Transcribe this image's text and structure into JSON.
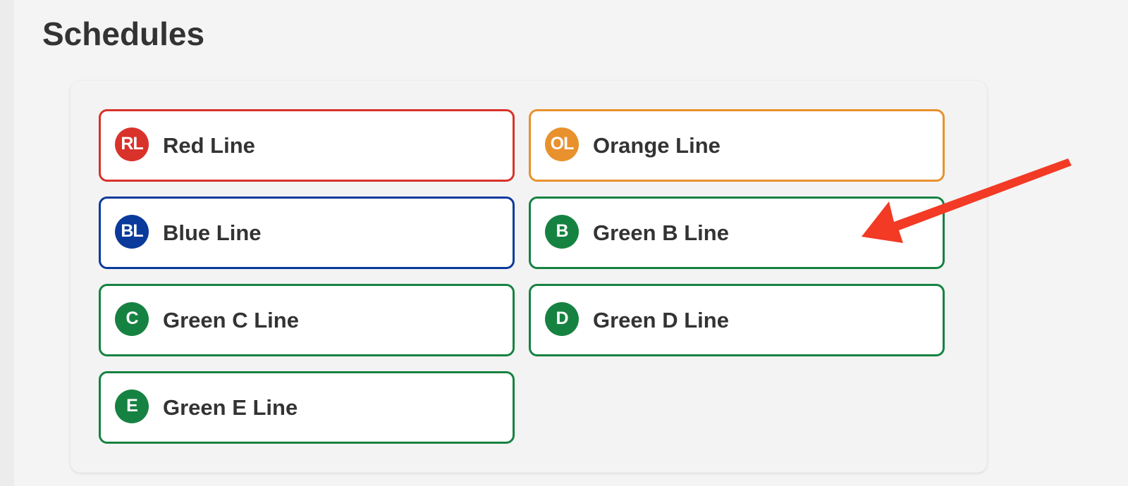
{
  "header": {
    "title": "Schedules"
  },
  "lines": [
    {
      "badge": "RL",
      "label": "Red Line",
      "color": "#d9322a",
      "badge_icon": "red-line-badge-icon"
    },
    {
      "badge": "OL",
      "label": "Orange Line",
      "color": "#e8912d",
      "badge_icon": "orange-line-badge-icon"
    },
    {
      "badge": "BL",
      "label": "Blue Line",
      "color": "#0a3a9c",
      "badge_icon": "blue-line-badge-icon"
    },
    {
      "badge": "B",
      "label": "Green B Line",
      "color": "#168241",
      "badge_icon": "green-b-line-badge-icon"
    },
    {
      "badge": "C",
      "label": "Green C Line",
      "color": "#168241",
      "badge_icon": "green-c-line-badge-icon"
    },
    {
      "badge": "D",
      "label": "Green D Line",
      "color": "#168241",
      "badge_icon": "green-d-line-badge-icon"
    },
    {
      "badge": "E",
      "label": "Green E Line",
      "color": "#168241",
      "badge_icon": "green-e-line-badge-icon"
    }
  ],
  "annotation": {
    "arrow_color": "#f23a25",
    "icon": "red-arrow-icon"
  }
}
